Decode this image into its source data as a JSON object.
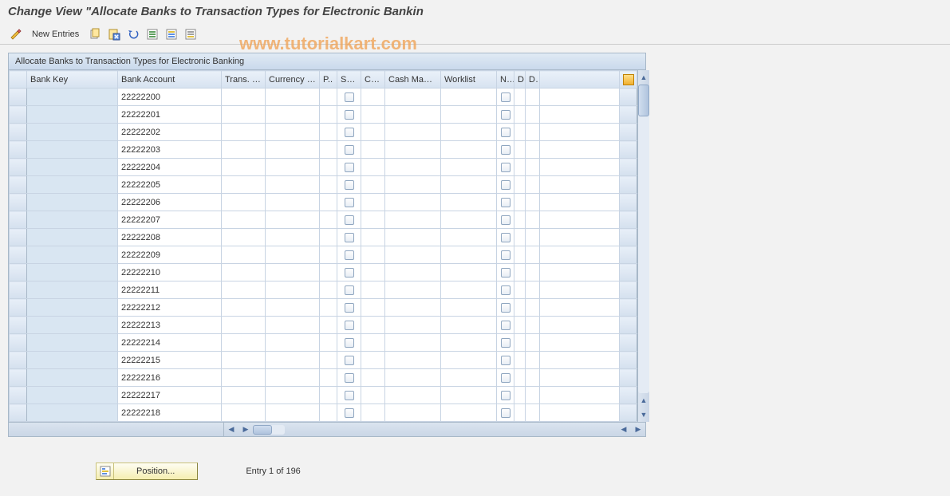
{
  "title": "Change View \"Allocate Banks to Transaction Types for Electronic Bankin",
  "toolbar": {
    "new_entries_label": "New Entries"
  },
  "panel_title": "Allocate Banks to Transaction Types for Electronic Banking",
  "columns": {
    "sel": "",
    "bank_key": "Bank Key",
    "bank_account": "Bank Account",
    "trans_type": "Trans. t...",
    "currency": "Currency c...",
    "p": "P..",
    "su": "Su...",
    "co": "Co...",
    "cash_mana": "Cash Mana...",
    "worklist": "Worklist",
    "n": "N..",
    "d1": "D",
    "d2": "D.."
  },
  "rows": [
    {
      "bank_key": "",
      "bank_account": "22222200"
    },
    {
      "bank_key": "",
      "bank_account": "22222201"
    },
    {
      "bank_key": "",
      "bank_account": "22222202"
    },
    {
      "bank_key": "",
      "bank_account": "22222203"
    },
    {
      "bank_key": "",
      "bank_account": "22222204"
    },
    {
      "bank_key": "",
      "bank_account": "22222205"
    },
    {
      "bank_key": "",
      "bank_account": "22222206"
    },
    {
      "bank_key": "",
      "bank_account": "22222207"
    },
    {
      "bank_key": "",
      "bank_account": "22222208"
    },
    {
      "bank_key": "",
      "bank_account": "22222209"
    },
    {
      "bank_key": "",
      "bank_account": "22222210"
    },
    {
      "bank_key": "",
      "bank_account": "22222211"
    },
    {
      "bank_key": "",
      "bank_account": "22222212"
    },
    {
      "bank_key": "",
      "bank_account": "22222213"
    },
    {
      "bank_key": "",
      "bank_account": "22222214"
    },
    {
      "bank_key": "",
      "bank_account": "22222215"
    },
    {
      "bank_key": "",
      "bank_account": "22222216"
    },
    {
      "bank_key": "",
      "bank_account": "22222217"
    },
    {
      "bank_key": "",
      "bank_account": "22222218"
    }
  ],
  "footer": {
    "position_label": "Position...",
    "entry_label": "Entry 1 of 196"
  },
  "watermark": "www.tutorialkart.com"
}
